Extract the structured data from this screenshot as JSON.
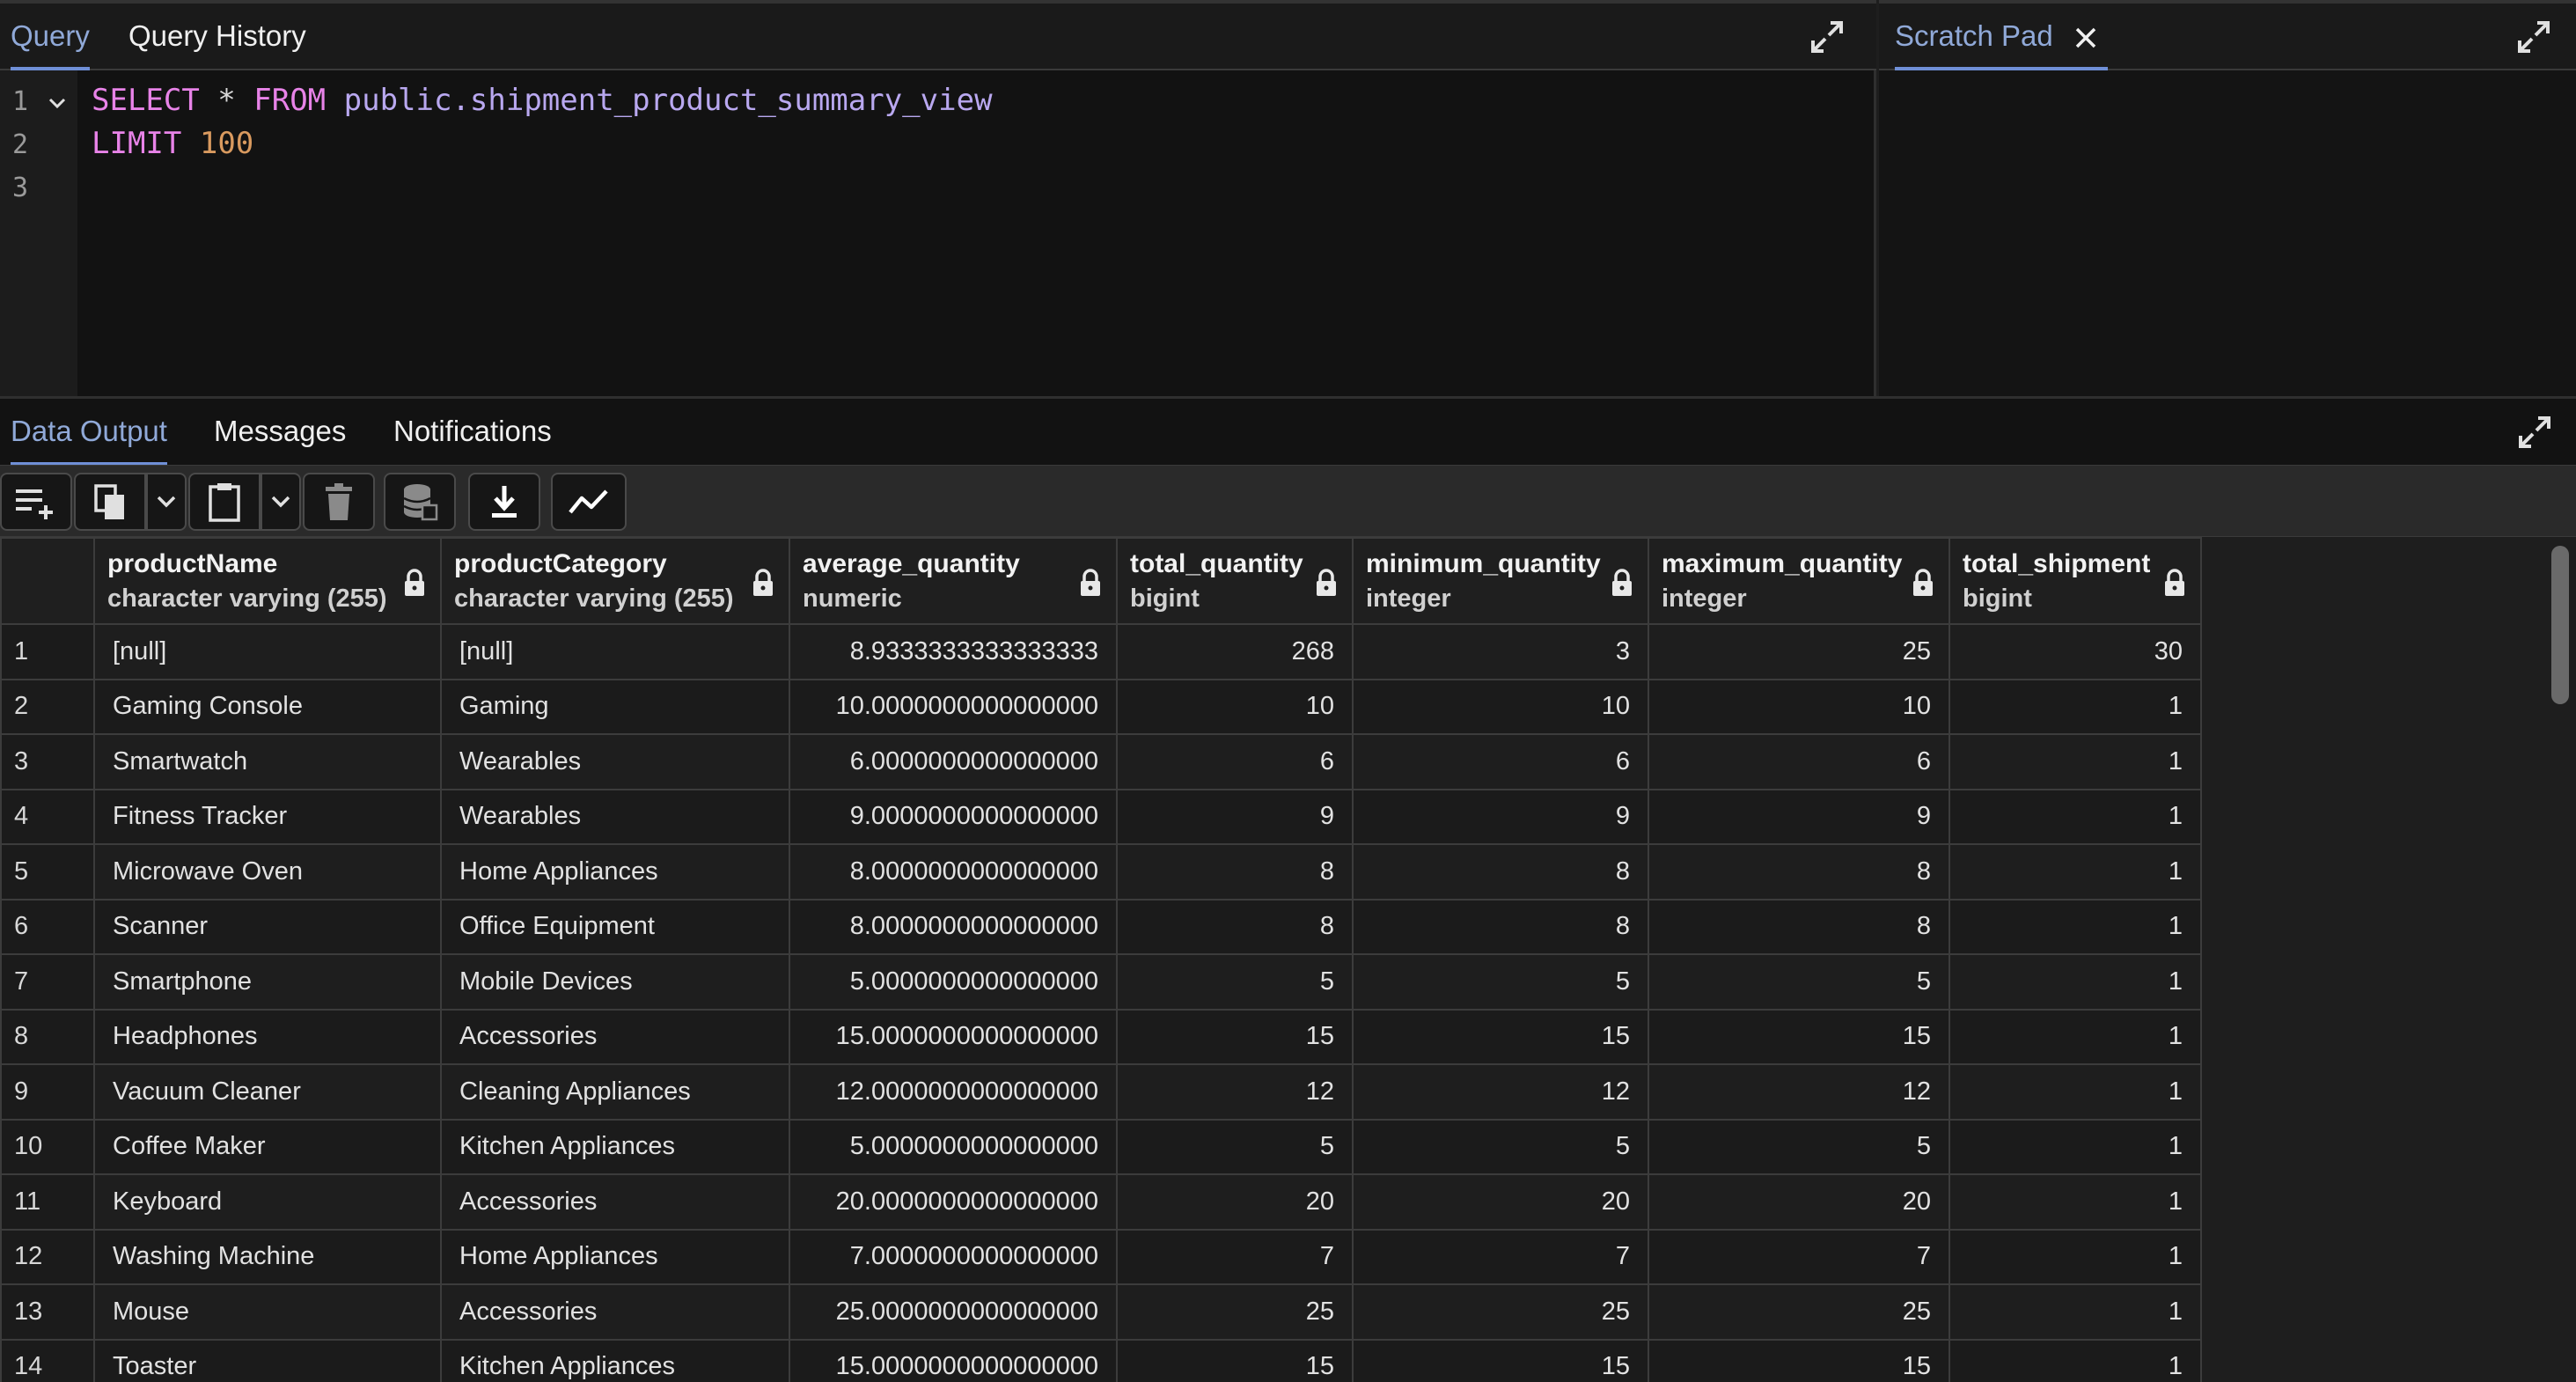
{
  "query_tabs": [
    {
      "label": "Query",
      "active": true
    },
    {
      "label": "Query History",
      "active": false
    }
  ],
  "scratch_tab": {
    "label": "Scratch Pad"
  },
  "editor": {
    "line_numbers": [
      "1",
      "2",
      "3"
    ],
    "line1": {
      "kw1": "SELECT",
      "star": " * ",
      "kw2": "FROM",
      "space": " ",
      "ident": "public.shipment_product_summary_view"
    },
    "line2": {
      "kw": "LIMIT",
      "space": " ",
      "num": "100"
    }
  },
  "output_tabs": [
    {
      "label": "Data Output",
      "active": true
    },
    {
      "label": "Messages",
      "active": false
    },
    {
      "label": "Notifications",
      "active": false
    }
  ],
  "toolbar": {
    "icons": [
      "add-row-icon",
      "copy-icon",
      "chevron-down-icon",
      "paste-icon",
      "chevron-down-icon",
      "delete-icon",
      "save-data-icon",
      "download-icon",
      "graph-icon"
    ]
  },
  "grid": {
    "columns": [
      {
        "name": "productName",
        "type": "character varying (255)"
      },
      {
        "name": "productCategory",
        "type": "character varying (255)"
      },
      {
        "name": "average_quantity",
        "type": "numeric"
      },
      {
        "name": "total_quantity",
        "type": "bigint"
      },
      {
        "name": "minimum_quantity",
        "type": "integer"
      },
      {
        "name": "maximum_quantity",
        "type": "integer"
      },
      {
        "name": "total_shipment",
        "type": "bigint"
      }
    ],
    "rows": [
      [
        "1",
        "[null]",
        "[null]",
        "8.9333333333333333",
        "268",
        "3",
        "25",
        "30"
      ],
      [
        "2",
        "Gaming Console",
        "Gaming",
        "10.0000000000000000",
        "10",
        "10",
        "10",
        "1"
      ],
      [
        "3",
        "Smartwatch",
        "Wearables",
        "6.0000000000000000",
        "6",
        "6",
        "6",
        "1"
      ],
      [
        "4",
        "Fitness Tracker",
        "Wearables",
        "9.0000000000000000",
        "9",
        "9",
        "9",
        "1"
      ],
      [
        "5",
        "Microwave Oven",
        "Home Appliances",
        "8.0000000000000000",
        "8",
        "8",
        "8",
        "1"
      ],
      [
        "6",
        "Scanner",
        "Office Equipment",
        "8.0000000000000000",
        "8",
        "8",
        "8",
        "1"
      ],
      [
        "7",
        "Smartphone",
        "Mobile Devices",
        "5.0000000000000000",
        "5",
        "5",
        "5",
        "1"
      ],
      [
        "8",
        "Headphones",
        "Accessories",
        "15.0000000000000000",
        "15",
        "15",
        "15",
        "1"
      ],
      [
        "9",
        "Vacuum Cleaner",
        "Cleaning Appliances",
        "12.0000000000000000",
        "12",
        "12",
        "12",
        "1"
      ],
      [
        "10",
        "Coffee Maker",
        "Kitchen Appliances",
        "5.0000000000000000",
        "5",
        "5",
        "5",
        "1"
      ],
      [
        "11",
        "Keyboard",
        "Accessories",
        "20.0000000000000000",
        "20",
        "20",
        "20",
        "1"
      ],
      [
        "12",
        "Washing Machine",
        "Home Appliances",
        "7.0000000000000000",
        "7",
        "7",
        "7",
        "1"
      ],
      [
        "13",
        "Mouse",
        "Accessories",
        "25.0000000000000000",
        "25",
        "25",
        "25",
        "1"
      ],
      [
        "14",
        "Toaster",
        "Kitchen Appliances",
        "15.0000000000000000",
        "15",
        "15",
        "15",
        "1"
      ]
    ]
  },
  "colors": {
    "accent": "#6f8fd6",
    "keyword": "#e883e8",
    "identifier": "#b9a8f0",
    "number": "#d99a5f"
  }
}
